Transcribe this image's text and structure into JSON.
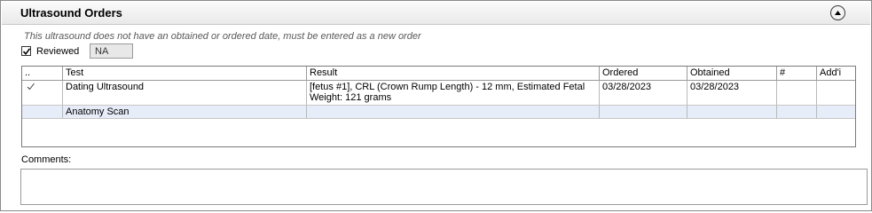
{
  "panel": {
    "title": "Ultrasound Orders"
  },
  "notice": "This ultrasound does not have an obtained or ordered date, must be entered as a new order",
  "reviewed": {
    "label": "Reviewed",
    "checked": true,
    "value": "NA"
  },
  "table": {
    "columns": [
      "..",
      "Test",
      "Result",
      "Ordered",
      "Obtained",
      "#",
      "Add'i"
    ],
    "rows": [
      {
        "mark": "✓",
        "test": "Dating Ultrasound",
        "result": "[fetus #1], CRL (Crown Rump Length) - 12 mm, Estimated Fetal Weight: 121 grams",
        "ordered": "03/28/2023",
        "obtained": "03/28/2023",
        "num": "",
        "addl": ""
      },
      {
        "mark": "",
        "test": "Anatomy Scan",
        "result": "",
        "ordered": "",
        "obtained": "",
        "num": "",
        "addl": ""
      }
    ]
  },
  "comments": {
    "label": "Comments:",
    "value": ""
  }
}
